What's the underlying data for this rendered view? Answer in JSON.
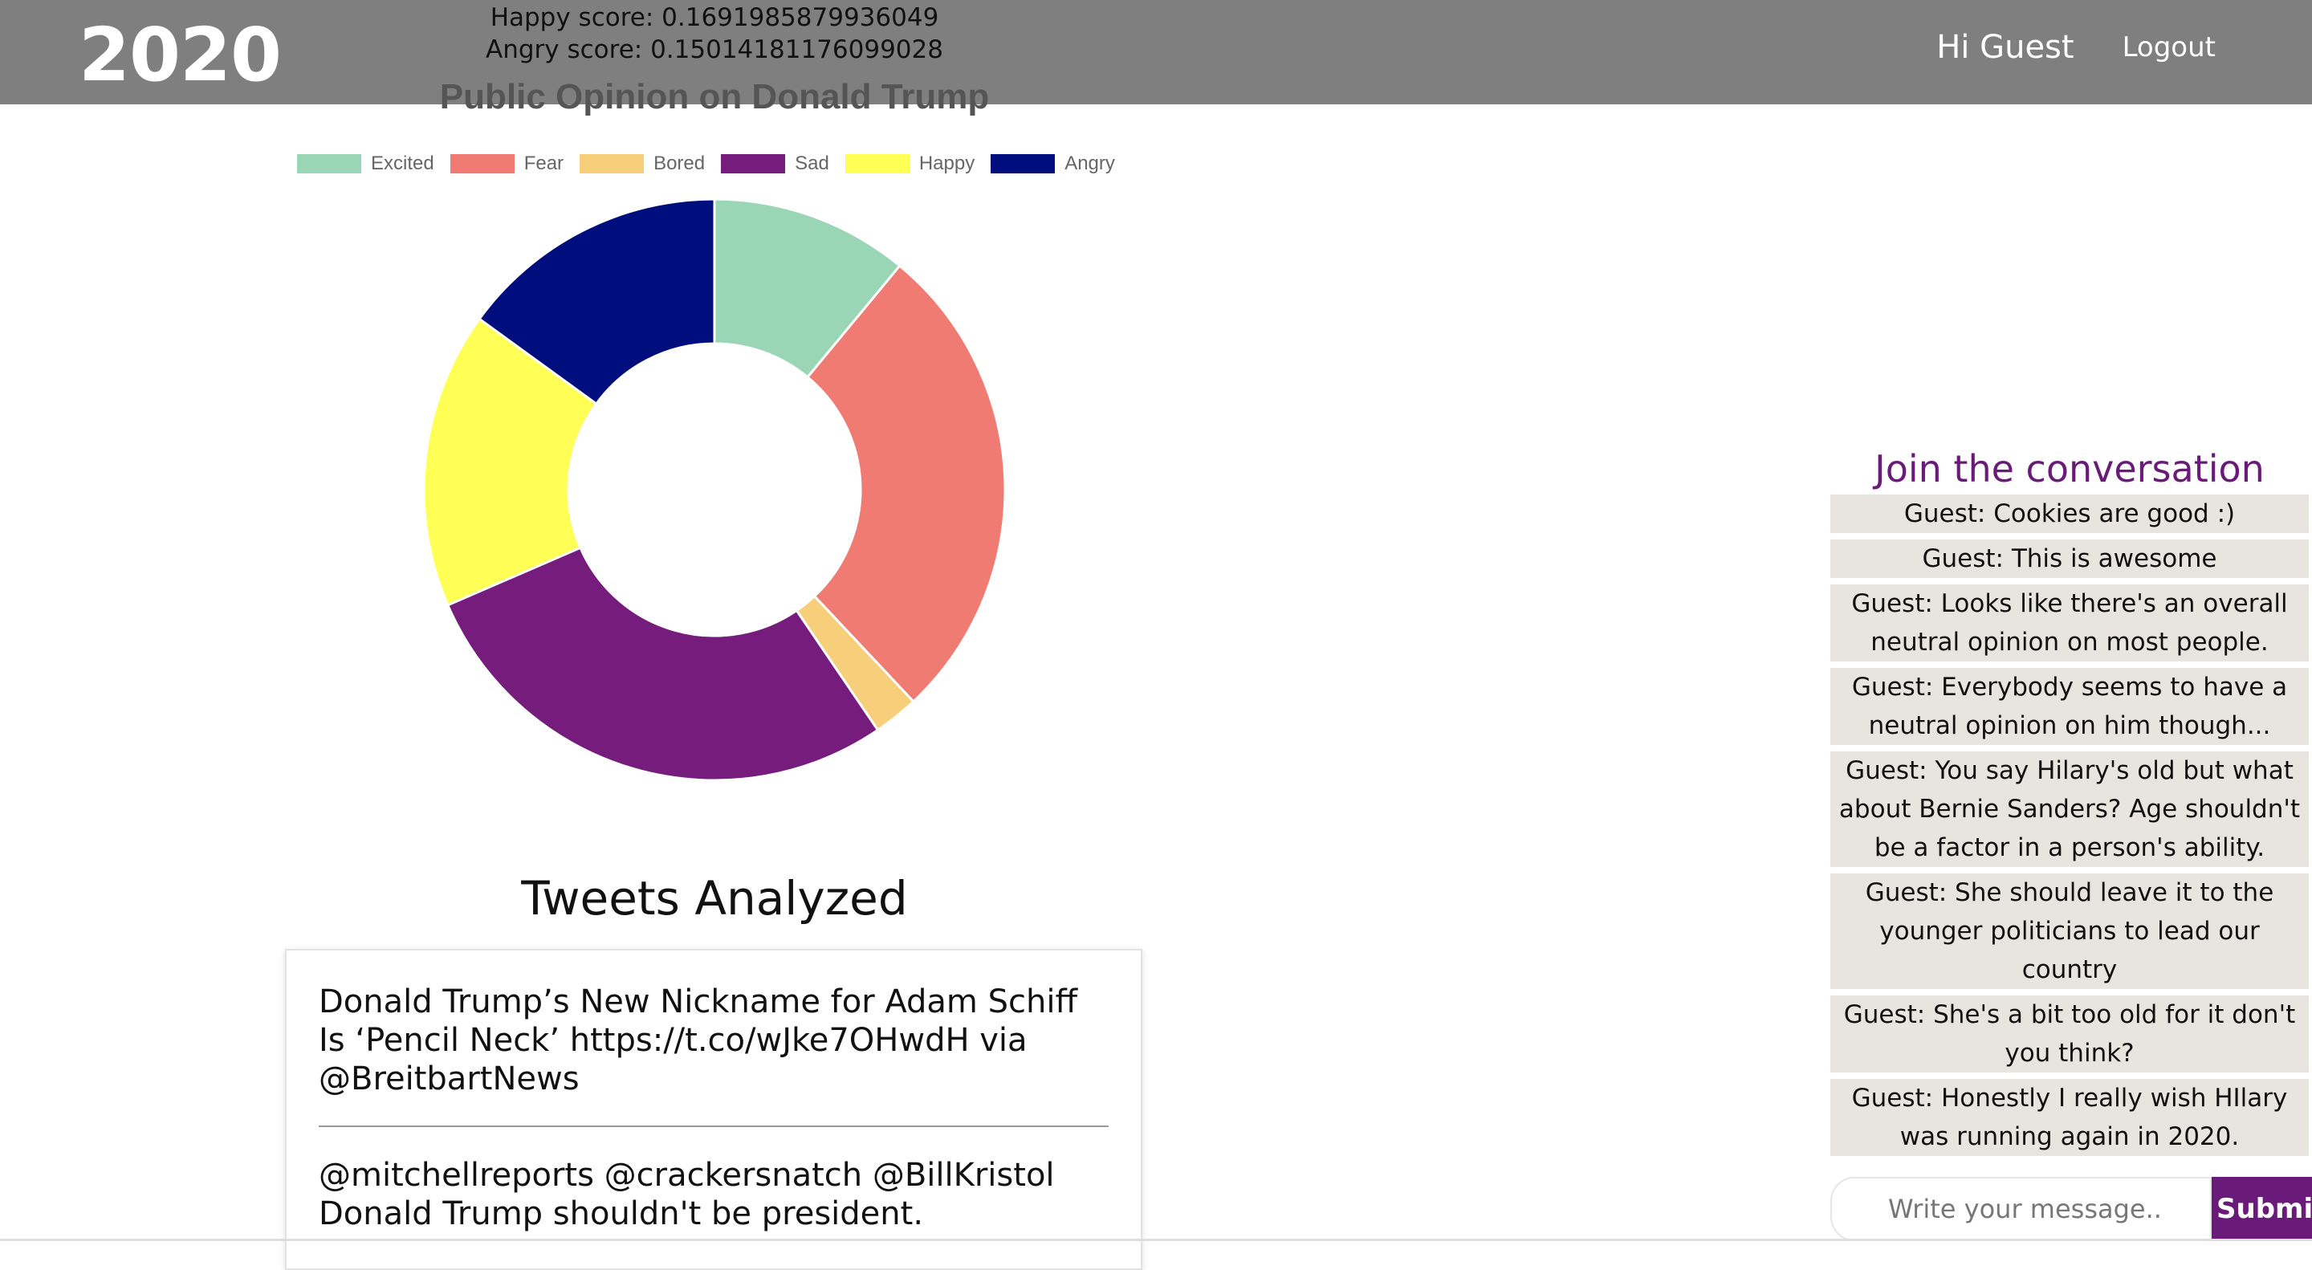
{
  "header": {
    "brand": "2020",
    "happy_score": "Happy score: 0.1691985879936049",
    "angry_score": "Angry score: 0.15014181176099028",
    "greeting": "Hi Guest",
    "logout": "Logout"
  },
  "chart_data": {
    "type": "pie",
    "title": "Public Opinion on Donald Trump",
    "legend_position": "top",
    "categories": [
      "Excited",
      "Fear",
      "Bored",
      "Sad",
      "Happy",
      "Angry"
    ],
    "values": [
      0.11,
      0.27,
      0.025,
      0.28,
      0.165,
      0.15
    ],
    "colors": [
      "#9ad5b5",
      "#f07b72",
      "#f7ce79",
      "#751c7c",
      "#ffff55",
      "#000e7d"
    ]
  },
  "tweets": {
    "heading": "Tweets Analyzed",
    "items": [
      "Donald Trump’s New Nickname for Adam Schiff Is ‘Pencil Neck’ https://t.co/wJke7OHwdH via @BreitbartNews",
      "@mitchellreports @crackersnatch @BillKristol Donald Trump shouldn't be president."
    ]
  },
  "chat": {
    "title": "Join the conversation",
    "messages": [
      "Guest: Cookies are good :)",
      "Guest: This is awesome",
      "Guest: Looks like there's an overall neutral opinion on most people.",
      "Guest: Everybody seems to have a neutral opinion on him though...",
      "Guest: You say Hilary's old but what about Bernie Sanders? Age shouldn't be a factor in a person's ability.",
      "Guest: She should leave it to the younger politicians to lead our country",
      "Guest: She's a bit too old for it don't you think?",
      "Guest: Honestly I really wish HIlary was running again in 2020."
    ],
    "input_placeholder": "Write your message..",
    "submit_label": "Submit"
  }
}
